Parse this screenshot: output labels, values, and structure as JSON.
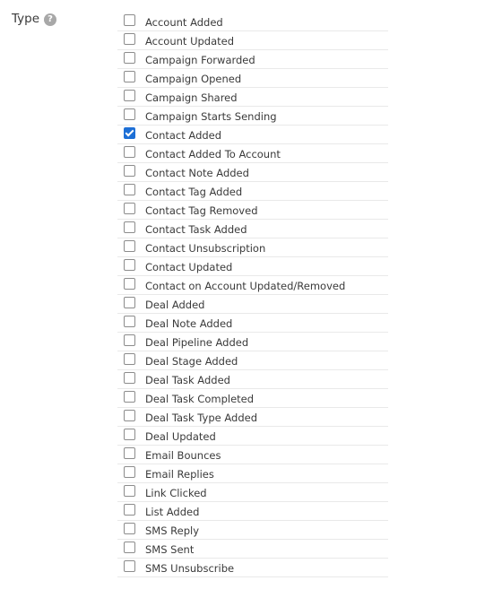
{
  "field": {
    "label": "Type",
    "help_glyph": "?"
  },
  "options": [
    {
      "label": "Account Added",
      "checked": false
    },
    {
      "label": "Account Updated",
      "checked": false
    },
    {
      "label": "Campaign Forwarded",
      "checked": false
    },
    {
      "label": "Campaign Opened",
      "checked": false
    },
    {
      "label": "Campaign Shared",
      "checked": false
    },
    {
      "label": "Campaign Starts Sending",
      "checked": false
    },
    {
      "label": "Contact Added",
      "checked": true
    },
    {
      "label": "Contact Added To Account",
      "checked": false
    },
    {
      "label": "Contact Note Added",
      "checked": false
    },
    {
      "label": "Contact Tag Added",
      "checked": false
    },
    {
      "label": "Contact Tag Removed",
      "checked": false
    },
    {
      "label": "Contact Task Added",
      "checked": false
    },
    {
      "label": "Contact Unsubscription",
      "checked": false
    },
    {
      "label": "Contact Updated",
      "checked": false
    },
    {
      "label": "Contact on Account Updated/Removed",
      "checked": false
    },
    {
      "label": "Deal Added",
      "checked": false
    },
    {
      "label": "Deal Note Added",
      "checked": false
    },
    {
      "label": "Deal Pipeline Added",
      "checked": false
    },
    {
      "label": "Deal Stage Added",
      "checked": false
    },
    {
      "label": "Deal Task Added",
      "checked": false
    },
    {
      "label": "Deal Task Completed",
      "checked": false
    },
    {
      "label": "Deal Task Type Added",
      "checked": false
    },
    {
      "label": "Deal Updated",
      "checked": false
    },
    {
      "label": "Email Bounces",
      "checked": false
    },
    {
      "label": "Email Replies",
      "checked": false
    },
    {
      "label": "Link Clicked",
      "checked": false
    },
    {
      "label": "List Added",
      "checked": false
    },
    {
      "label": "SMS Reply",
      "checked": false
    },
    {
      "label": "SMS Sent",
      "checked": false
    },
    {
      "label": "SMS Unsubscribe",
      "checked": false
    }
  ],
  "colors": {
    "checked_accent": "#1d6fd6",
    "divider": "#e9e9e9",
    "text": "#3a3a3a",
    "help_icon": "#a8a8a8"
  }
}
